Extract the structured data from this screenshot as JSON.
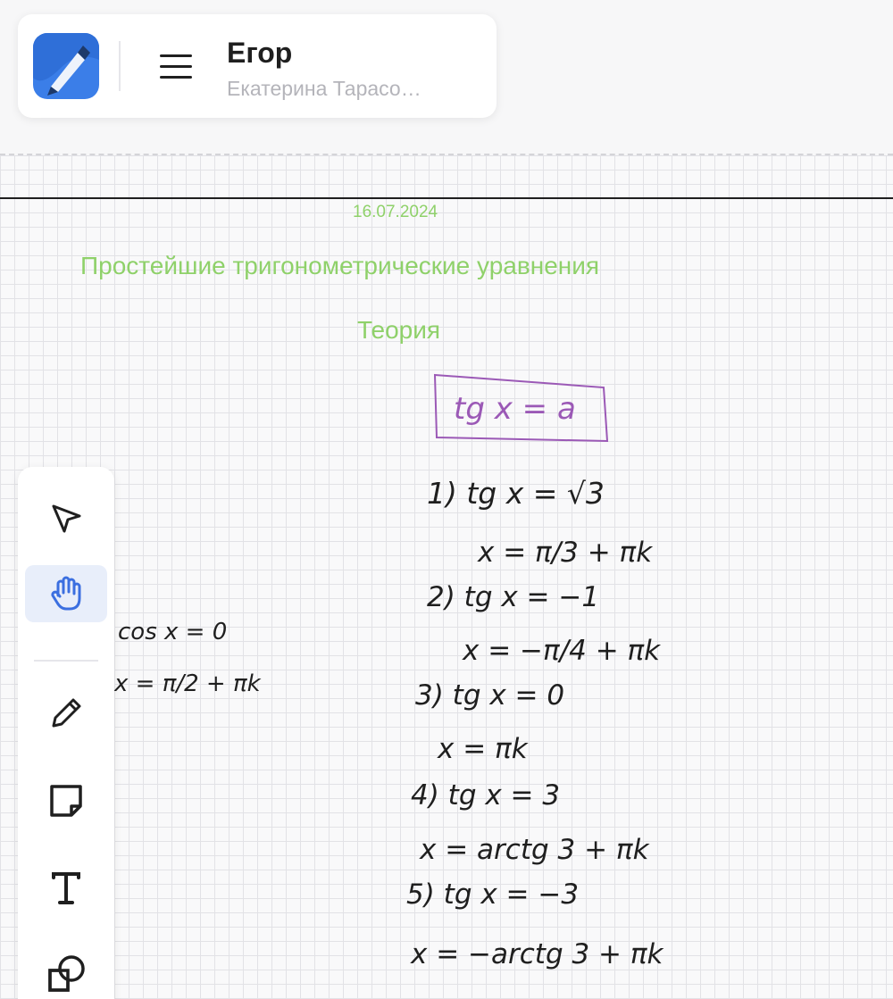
{
  "header": {
    "board_name": "Егор",
    "owner": "Екатерина Тарасо…"
  },
  "canvas": {
    "date": "16.07.2024",
    "title": "Простейшие тригонометрические уравнения",
    "subtitle": "Теория",
    "handwriting": {
      "boxed_formula": "tg x = a",
      "line_1a": "1) tg x = √3",
      "line_1b": "x = π/3 + πk",
      "line_2a": "2) tg x = −1",
      "line_2b": "x = −π/4 + πk",
      "line_3a": "3) tg x = 0",
      "line_3b": "x = πk",
      "line_4a": "4) tg x = 3",
      "line_4b": "x = arctg 3 + πk",
      "line_5a": "5) tg x = −3",
      "line_5b": "x = −arctg 3 + πk",
      "left_1": "cos x = 0",
      "left_2": "x = π/2 + πk"
    }
  },
  "toolbar": {
    "tools": [
      "select-icon",
      "hand-icon",
      "pen-icon",
      "sticky-note-icon",
      "text-icon",
      "shapes-icon"
    ],
    "active_tool": "hand-icon"
  },
  "colors": {
    "heading_green": "#8fd16a",
    "ink_purple": "#9b59b6",
    "ink_black": "#1f1f1f",
    "active_tool_bg": "#e8eefa",
    "active_tool_icon": "#3b6fe0"
  }
}
